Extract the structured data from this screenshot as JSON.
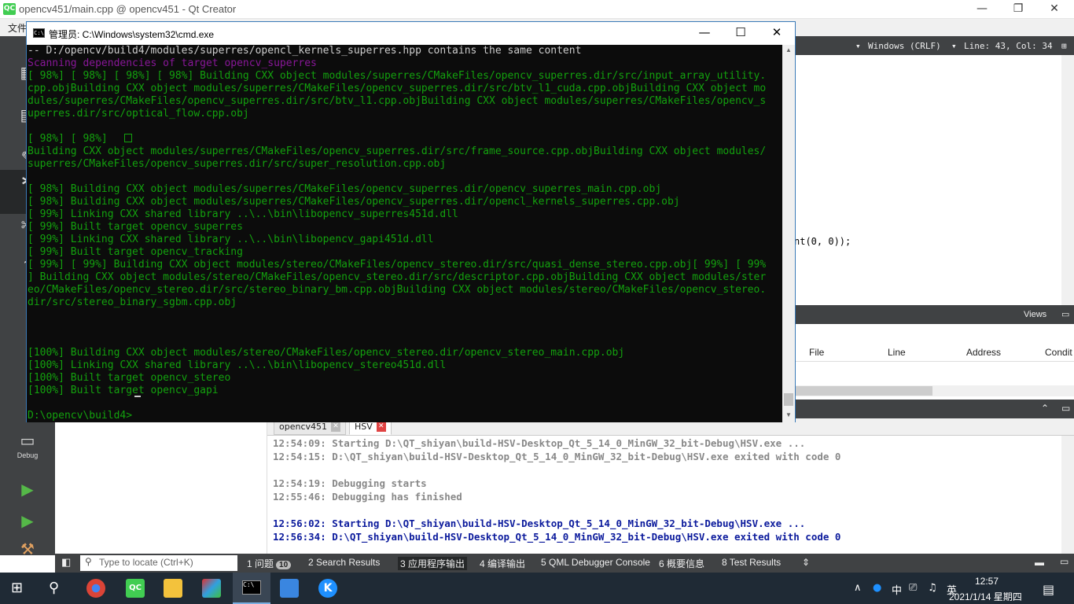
{
  "qt": {
    "window_title": "opencv451/main.cpp @ opencv451 - Qt Creator",
    "menu_file": "文件",
    "minimize": "—",
    "restore": "❐",
    "close": "✕",
    "modes": [
      {
        "label": "Debug"
      }
    ],
    "editor": {
      "line_ending": "Windows (CRLF)",
      "position": "Line: 43, Col: 34",
      "code_fragment": "nt(0, 0));"
    },
    "views_label": "Views",
    "breakpoints_columns": [
      "File",
      "Line",
      "Address",
      "Condit"
    ],
    "output_tabs": [
      "opencv451",
      "HSV"
    ],
    "output_lines": [
      {
        "text": "12:54:09: Starting D:\\QT_shiyan\\build-HSV-Desktop_Qt_5_14_0_MinGW_32_bit-Debug\\HSV.exe ...",
        "color": "#888888"
      },
      {
        "text": "12:54:15: D:\\QT_shiyan\\build-HSV-Desktop_Qt_5_14_0_MinGW_32_bit-Debug\\HSV.exe exited with code 0",
        "color": "#888888"
      },
      {
        "text": "12:54:19: Debugging starts",
        "color": "#888888"
      },
      {
        "text": "12:55:46: Debugging has finished",
        "color": "#888888"
      },
      {
        "text": "12:56:02: Starting D:\\QT_shiyan\\build-HSV-Desktop_Qt_5_14_0_MinGW_32_bit-Debug\\HSV.exe ...",
        "color": "#0b1a9c"
      },
      {
        "text": "12:56:34: D:\\QT_shiyan\\build-HSV-Desktop_Qt_5_14_0_MinGW_32_bit-Debug\\HSV.exe exited with code 0",
        "color": "#0b1a9c"
      }
    ],
    "locator_placeholder": "Type to locate (Ctrl+K)",
    "status_tabs": [
      {
        "label": "1 问题",
        "badge": "10"
      },
      {
        "label": "2 Search Results"
      },
      {
        "label": "3 应用程序输出"
      },
      {
        "label": "4 编译输出"
      },
      {
        "label": "5 QML Debugger Console"
      },
      {
        "label": "6 概要信息"
      },
      {
        "label": "8 Test Results"
      }
    ]
  },
  "cmd": {
    "title": "管理员: C:\\Windows\\system32\\cmd.exe",
    "icon_text": "C:\\",
    "lines": [
      {
        "text": "-- D:/opencv/build4/modules/superres/opencl_kernels_superres.hpp contains the same content",
        "color": "white"
      },
      {
        "text": "Scanning dependencies of target opencv_superres",
        "color": "magenta"
      },
      {
        "text": "[ 98%] [ 98%] [ 98%] [ 98%] Building CXX object modules/superres/CMakeFiles/opencv_superres.dir/src/input_array_utility.",
        "color": "green"
      },
      {
        "text": "cpp.objBuilding CXX object modules/superres/CMakeFiles/opencv_superres.dir/src/btv_l1_cuda.cpp.objBuilding CXX object mo",
        "color": "green"
      },
      {
        "text": "dules/superres/CMakeFiles/opencv_superres.dir/src/btv_l1.cpp.objBuilding CXX object modules/superres/CMakeFiles/opencv_s",
        "color": "green"
      },
      {
        "text": "uperres.dir/src/optical_flow.cpp.obj",
        "color": "green"
      },
      {
        "text": "",
        "color": "green"
      },
      {
        "text": "[ 98%] [ 98%]  ",
        "color": "green"
      },
      {
        "text": "Building CXX object modules/superres/CMakeFiles/opencv_superres.dir/src/frame_source.cpp.objBuilding CXX object modules/",
        "color": "green"
      },
      {
        "text": "superres/CMakeFiles/opencv_superres.dir/src/super_resolution.cpp.obj",
        "color": "green"
      },
      {
        "text": "",
        "color": "green"
      },
      {
        "text": "[ 98%] Building CXX object modules/superres/CMakeFiles/opencv_superres.dir/opencv_superres_main.cpp.obj",
        "color": "green"
      },
      {
        "text": "[ 98%] Building CXX object modules/superres/CMakeFiles/opencv_superres.dir/opencl_kernels_superres.cpp.obj",
        "color": "green"
      },
      {
        "text": "[ 99%] Linking CXX shared library ..\\..\\bin\\libopencv_superres451d.dll",
        "color": "green"
      },
      {
        "text": "[ 99%] Built target opencv_superres",
        "color": "green"
      },
      {
        "text": "[ 99%] Linking CXX shared library ..\\..\\bin\\libopencv_gapi451d.dll",
        "color": "green"
      },
      {
        "text": "[ 99%] Built target opencv_tracking",
        "color": "green"
      },
      {
        "text": "[ 99%] [ 99%] Building CXX object modules/stereo/CMakeFiles/opencv_stereo.dir/src/quasi_dense_stereo.cpp.obj[ 99%] [ 99%",
        "color": "green"
      },
      {
        "text": "] Building CXX object modules/stereo/CMakeFiles/opencv_stereo.dir/src/descriptor.cpp.objBuilding CXX object modules/ster",
        "color": "green"
      },
      {
        "text": "eo/CMakeFiles/opencv_stereo.dir/src/stereo_binary_bm.cpp.objBuilding CXX object modules/stereo/CMakeFiles/opencv_stereo.",
        "color": "green"
      },
      {
        "text": "dir/src/stereo_binary_sgbm.cpp.obj",
        "color": "green"
      },
      {
        "text": "",
        "color": "green"
      },
      {
        "text": "",
        "color": "green"
      },
      {
        "text": "",
        "color": "green"
      },
      {
        "text": "[100%] Building CXX object modules/stereo/CMakeFiles/opencv_stereo.dir/opencv_stereo_main.cpp.obj",
        "color": "green"
      },
      {
        "text": "[100%] Linking CXX shared library ..\\..\\bin\\libopencv_stereo451d.dll",
        "color": "green"
      },
      {
        "text": "[100%] Built target opencv_stereo",
        "color": "green"
      },
      {
        "text": "[100%] Built target opencv_gapi",
        "color": "green"
      },
      {
        "text": "",
        "color": "green"
      },
      {
        "text": "D:\\opencv\\build4>",
        "color": "green"
      }
    ]
  },
  "taskbar": {
    "time": "12:57",
    "date": "2021/1/14 星期四",
    "apps": [
      "windows-start",
      "search",
      "chrome",
      "qt-creator",
      "file-explorer",
      "app-triangle",
      "cmd",
      "notepad",
      "app-k"
    ],
    "colors": {
      "chrome": "#db4437",
      "qt": "#41cd52",
      "explorer": "#f3c23c",
      "k": "#1e90ff"
    }
  }
}
